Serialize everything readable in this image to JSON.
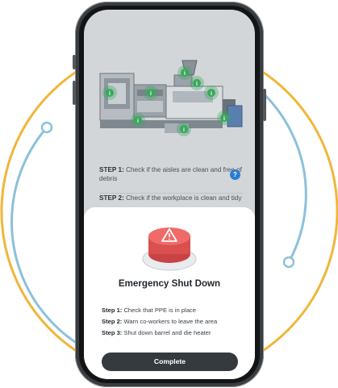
{
  "checklist": {
    "steps": [
      {
        "label": "STEP 1:",
        "text": "Check if the aisles are clean and free of debris"
      },
      {
        "label": "STEP 2:",
        "text": "Check if the workplace is clean and tidy"
      }
    ],
    "help_glyph": "?"
  },
  "hotspot_glyph": "i",
  "emergency": {
    "title": "Emergency Shut Down",
    "steps": [
      {
        "label": "Step 1:",
        "text": "Check that PPE is in place"
      },
      {
        "label": "Step 2:",
        "text": "Warn co-workers to leave the area"
      },
      {
        "label": "Step 3:",
        "text": "Shut down barrel and die heater"
      }
    ],
    "complete_label": "Complete"
  },
  "icons": [
    "info-hotspot-icon",
    "help-icon",
    "warning-icon",
    "emergency-stop-button"
  ],
  "colors": {
    "ring_orange": "#f0b63a",
    "ring_blue": "#8cc1d9",
    "hotspot_green": "#3aa85e",
    "stop_red": "#e8585a",
    "button_dark": "#353a3f",
    "help_blue": "#2b7cd3"
  }
}
